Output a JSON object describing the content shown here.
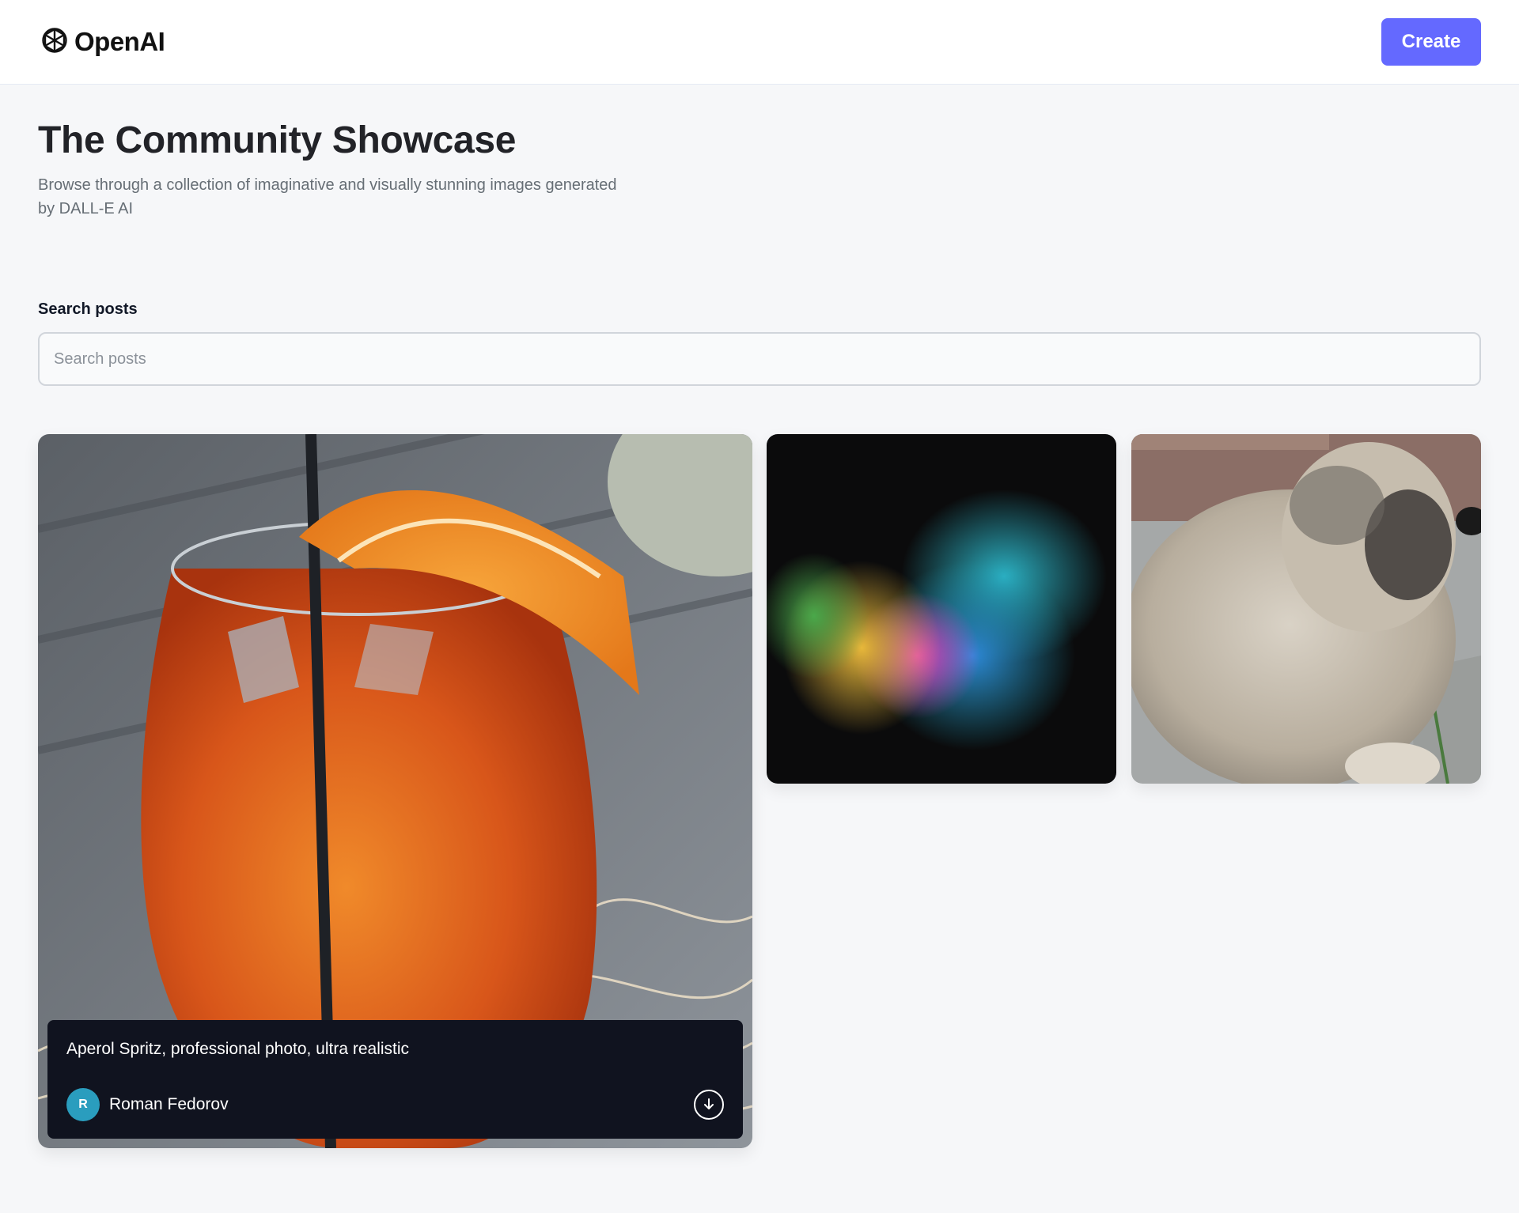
{
  "header": {
    "logo_text": "OpenAI",
    "create_label": "Create"
  },
  "hero": {
    "title": "The Community Showcase",
    "subtitle": "Browse through a collection of imaginative and visually stunning images generated by DALL-E AI"
  },
  "search": {
    "label": "Search posts",
    "placeholder": "Search posts",
    "value": ""
  },
  "posts": [
    {
      "prompt": "Aperol Spritz, professional photo, ultra realistic",
      "author": "Roman Fedorov",
      "avatar_initial": "R",
      "avatar_color": "#2a9dbe"
    }
  ],
  "icons": {
    "logo": "openai-logo-icon",
    "download": "download-icon"
  },
  "colors": {
    "accent": "#6469ff",
    "overlay": "#10131f",
    "background": "#f6f7f9"
  }
}
